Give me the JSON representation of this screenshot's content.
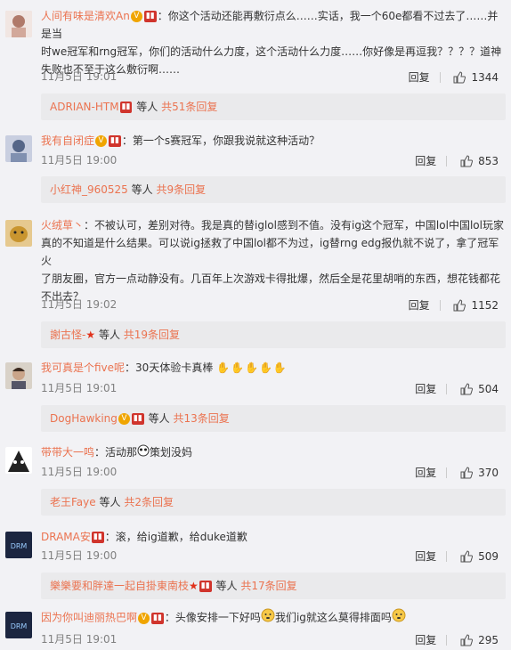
{
  "comments": [
    {
      "name": "人间有味是清欢An",
      "text_line1": "：你这个活动还能再敷衍点么……实话，我一个60e都看不过去了……并是当",
      "text_line2": "时we冠军和rng冠军，你们的活动什么力度，这个活动什么力度……你好像是再逗我？？？？道神",
      "text_line3": "失败也不至于这么敷衍啊……",
      "time": "11月5日 19:01",
      "reply": "回复",
      "likes": "1344",
      "replies": {
        "who": "ADRIAN-HTM",
        "mid": "等人",
        "more": "共51条回复"
      }
    },
    {
      "name": "我有自闭症",
      "text_line1": "：第一个s赛冠军，你跟我说就这种活动？",
      "time": "11月5日 19:00",
      "reply": "回复",
      "likes": "853",
      "replies": {
        "who": "小红神_960525",
        "mid": "等人",
        "more": "共9条回复"
      }
    },
    {
      "name": "火绒草丶",
      "text_line1": "：不被认可，差别对待。我是真的替iglol感到不值。没有ig这个冠军，中国lol中国lol玩家",
      "text_line2": "真的不知道是什么结果。可以说ig拯救了中国lol都不为过，ig替rng edg报仇就不说了，拿了冠军火",
      "text_line3": "了朋友圈，官方一点动静没有。几百年上次游戏卡得批爆，然后全是花里胡哨的东西，想花钱都花",
      "text_line4": "不出去？",
      "time": "11月5日 19:02",
      "reply": "回复",
      "likes": "1152",
      "replies": {
        "who": "謝古怪-",
        "mid": "等人",
        "more": "共19条回复"
      }
    },
    {
      "name": "我可真是个five呢",
      "text_line1": "：30天体验卡真棒",
      "time": "11月5日 19:01",
      "reply": "回复",
      "likes": "504",
      "replies": {
        "who": "DogHawking",
        "mid": "等人",
        "more": "共13条回复"
      }
    },
    {
      "name": "带带大一鸣",
      "text_line1": "：活动那",
      "text_line1b": "策划没妈",
      "time": "11月5日 19:00",
      "reply": "回复",
      "likes": "370",
      "replies": {
        "who": "老王Faye",
        "mid": "等人",
        "more": "共2条回复"
      }
    },
    {
      "name": "DRAMA安",
      "text_line1": "：滚，给ig道歉，给duke道歉",
      "time": "11月5日 19:00",
      "reply": "回复",
      "likes": "509",
      "replies": {
        "who": "樂樂要和胖達一起自掛東南枝",
        "mid": "等人",
        "more": "共17条回复"
      }
    },
    {
      "name": "因为你叫迪丽热巴啊",
      "text_line1": "：头像安排一下好吗",
      "text_line1b": "我们ig就这么莫得排面吗",
      "time": "11月5日 19:01",
      "reply": "回复",
      "likes": "295"
    }
  ],
  "colors": {
    "name": "#eb7350",
    "meta": "#808080",
    "reply_box": "#eaeaec",
    "bg": "#f2f2f5"
  },
  "icons": [
    "thumbs-up-icon",
    "vip-badge-icon",
    "medal-badge-icon",
    "sweat-emoji-icon",
    "red-star-icon"
  ]
}
